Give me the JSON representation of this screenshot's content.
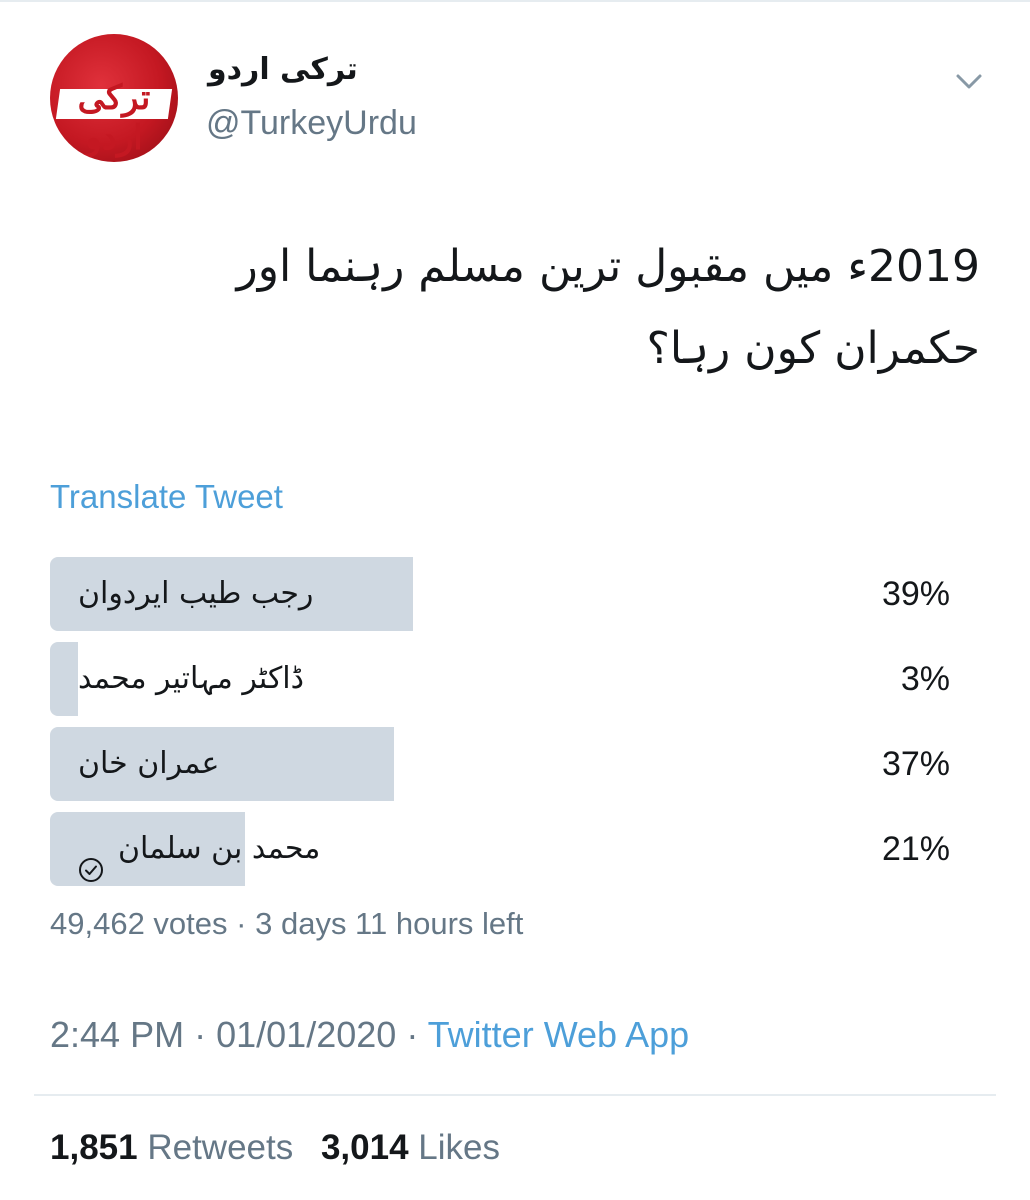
{
  "tweet": {
    "avatar_logo_text": "ترکی اردو",
    "display_name": "ترکی اردو",
    "handle": "@TurkeyUrdu",
    "text_line_1": "2019ء میں مقبول ترین مسلم رہنما اور",
    "text_line_2": "حکمران کون رہا؟",
    "translate_label": "Translate Tweet"
  },
  "poll": {
    "options": [
      {
        "label": "رجب طیب ایردوان",
        "percent_text": "39%",
        "percent": 39,
        "selected": false
      },
      {
        "label": "ڈاکٹر مہاتیر محمد",
        "percent_text": "3%",
        "percent": 3,
        "selected": false
      },
      {
        "label": "عمران خان",
        "percent_text": "37%",
        "percent": 37,
        "selected": false
      },
      {
        "label": "محمد بن سلمان",
        "percent_text": "21%",
        "percent": 21,
        "selected": true
      }
    ],
    "votes": "49,462 votes",
    "separator": "·",
    "time_left": "3 days 11 hours left"
  },
  "meta": {
    "time": "2:44 PM",
    "date": "01/01/2020",
    "separator": "·",
    "source": "Twitter Web App"
  },
  "stats": {
    "retweets_count": "1,851",
    "retweets_label": "Retweets",
    "likes_count": "3,014",
    "likes_label": "Likes"
  },
  "colors": {
    "accent": "#4d9fd9",
    "secondary_text": "#657786",
    "poll_bar": "#cfd8e1",
    "avatar_red": "#c41822"
  },
  "icons": {
    "menu": "chevron-down-icon",
    "poll_selected": "check-circle-icon"
  }
}
